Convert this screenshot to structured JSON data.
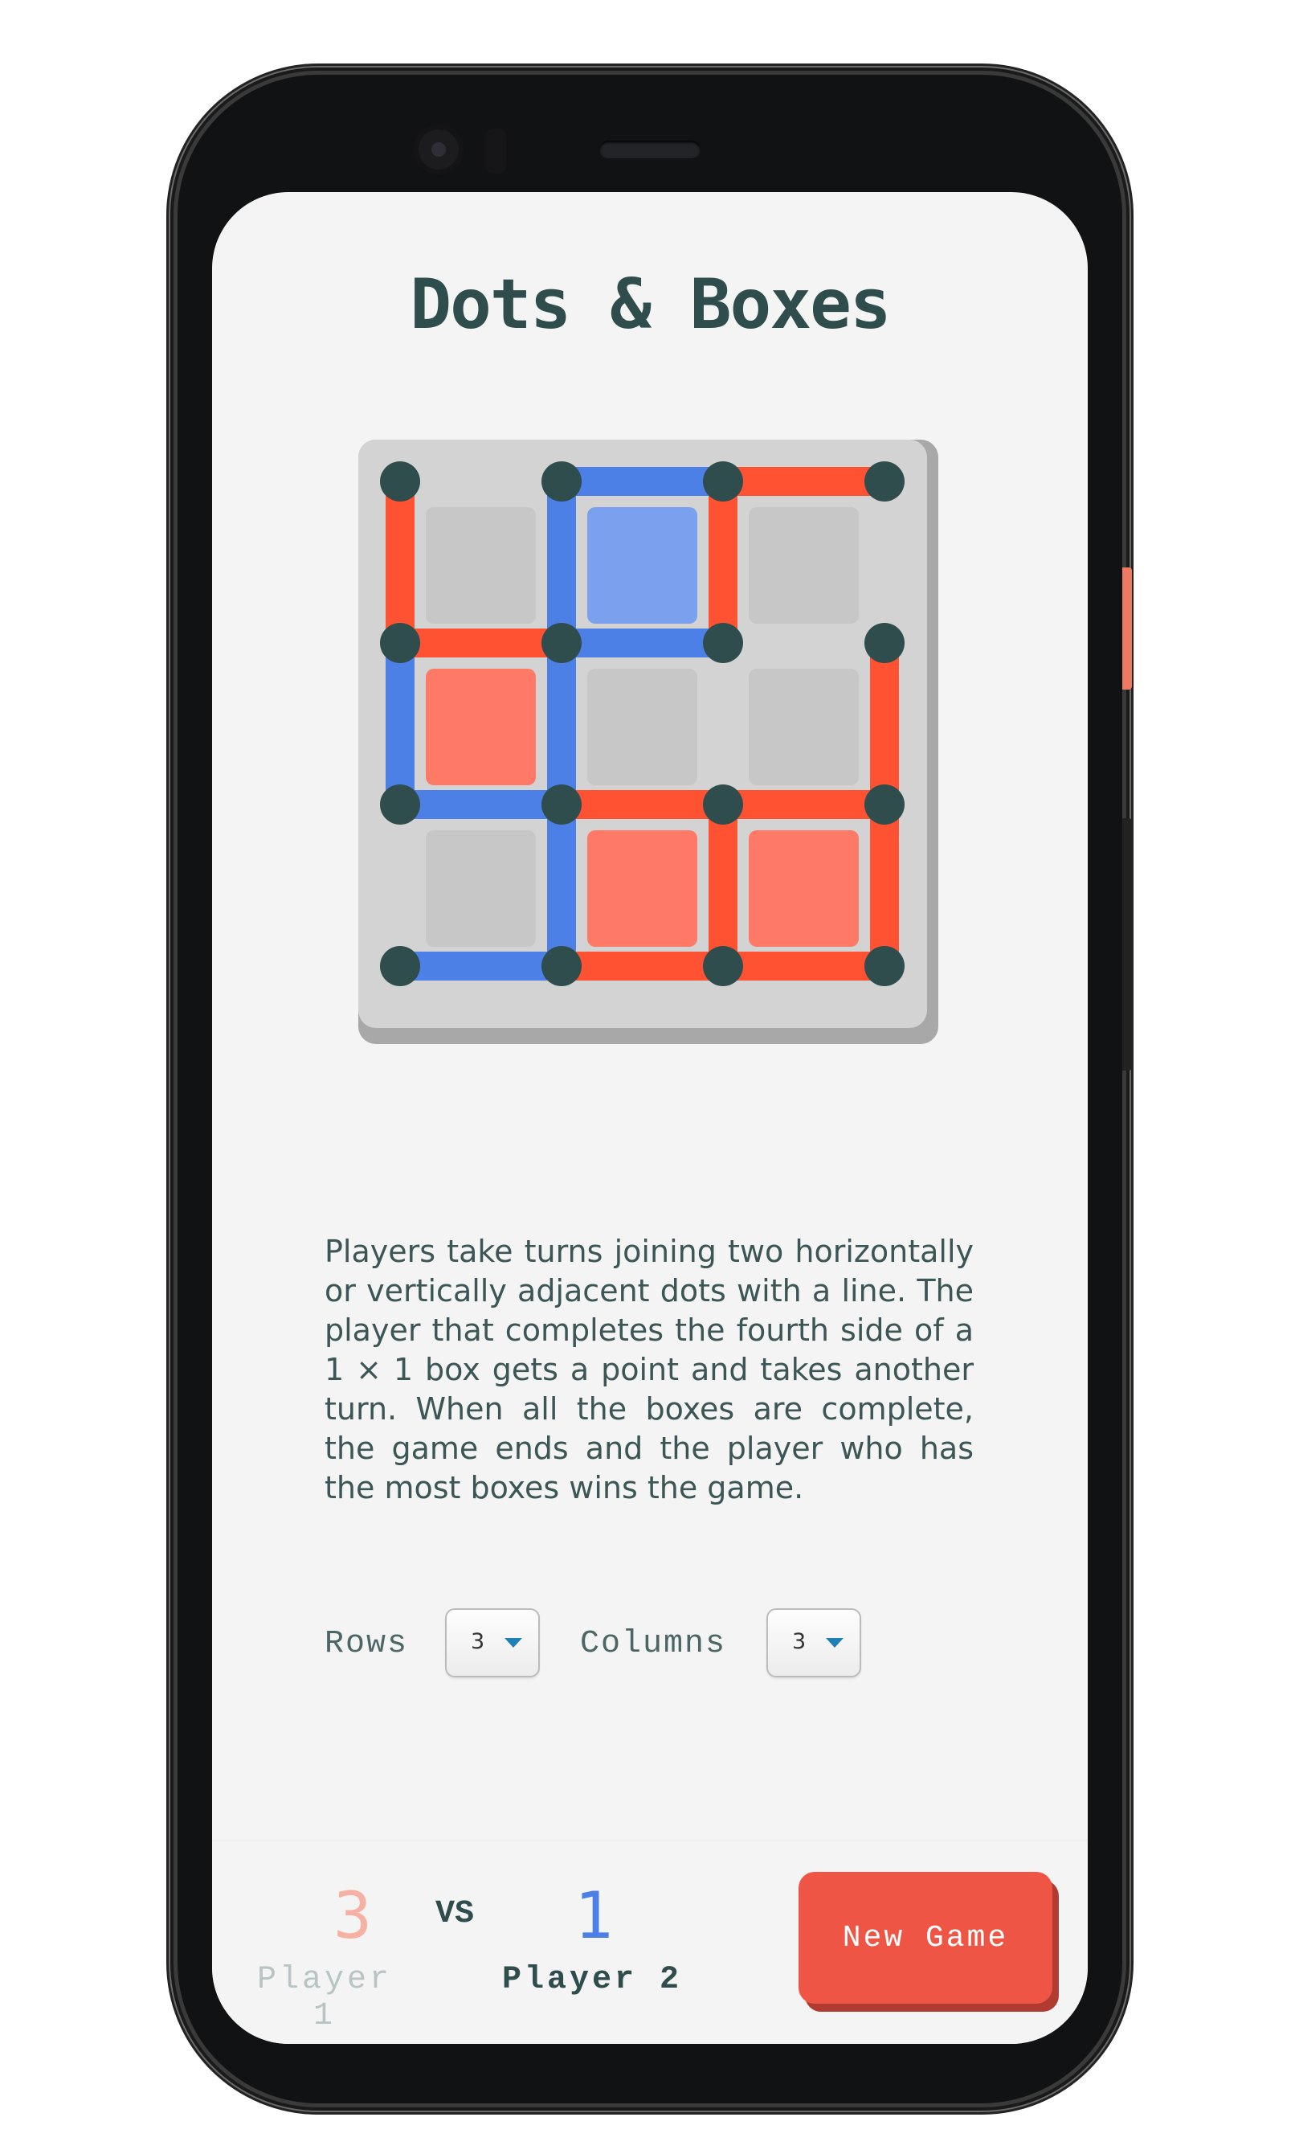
{
  "app": {
    "title": "Dots & Boxes"
  },
  "colors": {
    "player1": "#ff5233",
    "player1_box": "#ff7a66",
    "player2": "#4d80e6",
    "player2_box": "#7aa0ee",
    "dot": "#2f4d4c",
    "board_bg": "#d3d3d3",
    "empty_box": "#c7c7c7",
    "accent_button": "#ee5545",
    "select_caret": "#1f7fb7"
  },
  "board": {
    "rows": 3,
    "columns": 3,
    "horizontal_lines": [
      [
        null,
        "p2",
        "p1"
      ],
      [
        "p1",
        "p2",
        null
      ],
      [
        "p2",
        "p1",
        "p1"
      ],
      [
        "p2",
        "p1",
        "p1"
      ]
    ],
    "vertical_lines": [
      [
        "p1",
        "p2",
        "p1",
        null
      ],
      [
        "p2",
        "p2",
        null,
        "p1"
      ],
      [
        null,
        "p2",
        "p1",
        "p1"
      ]
    ],
    "boxes": [
      [
        null,
        "p2",
        null
      ],
      [
        "p1",
        null,
        null
      ],
      [
        null,
        "p1",
        "p1"
      ]
    ]
  },
  "description": "Players take turns joining two horizontally or vertically adjacent dots with a line. The player that completes the fourth side of a 1 × 1 box gets a point and takes another turn. When all the boxes are complete, the game ends and the player who has the most boxes wins the game.",
  "settings": {
    "rows_label": "Rows",
    "rows_value": "3",
    "columns_label": "Columns",
    "columns_value": "3"
  },
  "footer": {
    "player1_score": "3",
    "player1_label": "Player 1",
    "vs_label": "VS",
    "player2_score": "1",
    "player2_label": "Player 2",
    "new_game_label": "New Game",
    "player1_score_color": "#f6b1a4",
    "player1_label_color": "#b8c4c3",
    "player2_score_color": "#4d80e6",
    "player2_label_color": "#2f4d4c"
  }
}
